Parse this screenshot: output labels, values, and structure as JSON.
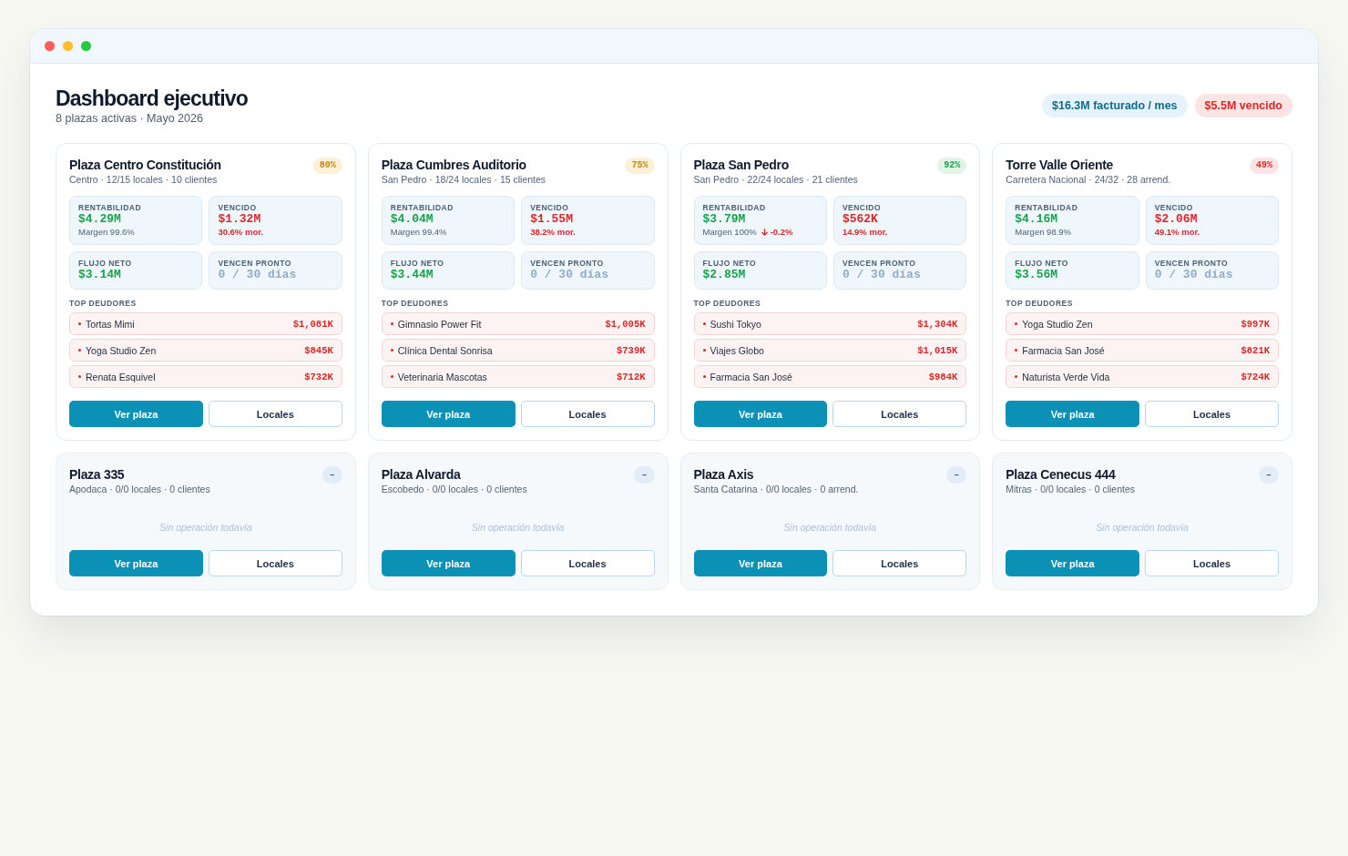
{
  "header": {
    "title": "Dashboard ejecutivo",
    "subtitle": "8 plazas activas · Mayo 2026",
    "pills": [
      {
        "text": "$16.3M facturado / mes",
        "kind": "info"
      },
      {
        "text": "$5.5M vencido",
        "kind": "danger"
      }
    ]
  },
  "plazas": [
    {
      "kind": "operating",
      "name": "Plaza Centro Constitución",
      "details": "Centro · 12/15 locales · 10 clientes",
      "badge": {
        "text": "80%",
        "kind": "warning"
      },
      "metrics": [
        {
          "label": "RENTABILIDAD",
          "value": "$4.29M",
          "kind": "positive",
          "note": {
            "text": "Margen 99.6%",
            "kind": "neutral"
          }
        },
        {
          "label": "VENCIDO",
          "value": "$1.32M",
          "kind": "negative",
          "note": {
            "text": "30.6% mor.",
            "kind": "negative"
          }
        },
        {
          "label": "FLUJO NETO",
          "value": "$3.14M",
          "kind": "positive"
        },
        {
          "label": "VENCEN PRONTO",
          "value": "0 / 30 días",
          "kind": "muted"
        }
      ],
      "debtors_title": "TOP DEUDORES",
      "debtors": [
        {
          "name": "Tortas Mimi",
          "amount": "$1,081K"
        },
        {
          "name": "Yoga Studio Zen",
          "amount": "$845K"
        },
        {
          "name": "Renata Esquivel",
          "amount": "$732K"
        }
      ],
      "actions": [
        {
          "label": "Ver plaza",
          "kind": "primary"
        },
        {
          "label": "Locales",
          "kind": "secondary"
        }
      ]
    },
    {
      "kind": "operating",
      "name": "Plaza Cumbres Auditorio",
      "details": "San Pedro · 18/24 locales · 15 clientes",
      "badge": {
        "text": "75%",
        "kind": "warning"
      },
      "metrics": [
        {
          "label": "RENTABILIDAD",
          "value": "$4.04M",
          "kind": "positive",
          "note": {
            "text": "Margen 99.4%",
            "kind": "neutral"
          }
        },
        {
          "label": "VENCIDO",
          "value": "$1.55M",
          "kind": "negative",
          "note": {
            "text": "38.2% mor.",
            "kind": "negative"
          }
        },
        {
          "label": "FLUJO NETO",
          "value": "$3.44M",
          "kind": "positive"
        },
        {
          "label": "VENCEN PRONTO",
          "value": "0 / 30 días",
          "kind": "muted"
        }
      ],
      "debtors_title": "TOP DEUDORES",
      "debtors": [
        {
          "name": "Gimnasio Power Fit",
          "amount": "$1,005K"
        },
        {
          "name": "Clínica Dental Sonrisa",
          "amount": "$739K"
        },
        {
          "name": "Veterinaria Mascotas",
          "amount": "$712K"
        }
      ],
      "actions": [
        {
          "label": "Ver plaza",
          "kind": "primary"
        },
        {
          "label": "Locales",
          "kind": "secondary"
        }
      ]
    },
    {
      "kind": "operating",
      "name": "Plaza San Pedro",
      "details": "San Pedro · 22/24 locales · 21 clientes",
      "badge": {
        "text": "92%",
        "kind": "success"
      },
      "metrics": [
        {
          "label": "RENTABILIDAD",
          "value": "$3.79M",
          "kind": "positive",
          "note": {
            "text": "Margen 100%",
            "kind": "neutral",
            "delta": {
              "text": "-0.2%",
              "kind": "down"
            }
          }
        },
        {
          "label": "VENCIDO",
          "value": "$562K",
          "kind": "negative",
          "note": {
            "text": "14.9% mor.",
            "kind": "negative"
          }
        },
        {
          "label": "FLUJO NETO",
          "value": "$2.85M",
          "kind": "positive"
        },
        {
          "label": "VENCEN PRONTO",
          "value": "0 / 30 días",
          "kind": "muted"
        }
      ],
      "debtors_title": "TOP DEUDORES",
      "debtors": [
        {
          "name": "Sushi Tokyo",
          "amount": "$1,304K"
        },
        {
          "name": "Viajes Globo",
          "amount": "$1,015K"
        },
        {
          "name": "Farmacia San José",
          "amount": "$984K"
        }
      ],
      "actions": [
        {
          "label": "Ver plaza",
          "kind": "primary"
        },
        {
          "label": "Locales",
          "kind": "secondary"
        }
      ]
    },
    {
      "kind": "operating",
      "name": "Torre Valle Oriente",
      "details": "Carretera Nacional · 24/32 · 28 arrend.",
      "badge": {
        "text": "49%",
        "kind": "danger"
      },
      "metrics": [
        {
          "label": "RENTABILIDAD",
          "value": "$4.16M",
          "kind": "positive",
          "note": {
            "text": "Margen 98.9%",
            "kind": "neutral"
          }
        },
        {
          "label": "VENCIDO",
          "value": "$2.06M",
          "kind": "negative",
          "note": {
            "text": "49.1% mor.",
            "kind": "negative"
          }
        },
        {
          "label": "FLUJO NETO",
          "value": "$3.56M",
          "kind": "positive"
        },
        {
          "label": "VENCEN PRONTO",
          "value": "0 / 30 días",
          "kind": "muted"
        }
      ],
      "debtors_title": "TOP DEUDORES",
      "debtors": [
        {
          "name": "Yoga Studio Zen",
          "amount": "$997K"
        },
        {
          "name": "Farmacia San José",
          "amount": "$821K"
        },
        {
          "name": "Naturista Verde Vida",
          "amount": "$724K"
        }
      ],
      "actions": [
        {
          "label": "Ver plaza",
          "kind": "primary"
        },
        {
          "label": "Locales",
          "kind": "secondary"
        }
      ]
    },
    {
      "kind": "empty",
      "name": "Plaza 335",
      "details": "Apodaca · 0/0 locales · 0 clientes",
      "badge": {
        "text": "–",
        "kind": "neutral"
      },
      "empty_message": "Sin operación todavía",
      "actions": [
        {
          "label": "Ver plaza",
          "kind": "primary"
        },
        {
          "label": "Locales",
          "kind": "secondary"
        }
      ]
    },
    {
      "kind": "empty",
      "name": "Plaza Alvarda",
      "details": "Escobedo · 0/0 locales · 0 clientes",
      "badge": {
        "text": "–",
        "kind": "neutral"
      },
      "empty_message": "Sin operación todavía",
      "actions": [
        {
          "label": "Ver plaza",
          "kind": "primary"
        },
        {
          "label": "Locales",
          "kind": "secondary"
        }
      ]
    },
    {
      "kind": "empty",
      "name": "Plaza Axis",
      "details": "Santa Catarina · 0/0 locales · 0 arrend.",
      "badge": {
        "text": "–",
        "kind": "neutral"
      },
      "empty_message": "Sin operación todavía",
      "actions": [
        {
          "label": "Ver plaza",
          "kind": "primary"
        },
        {
          "label": "Locales",
          "kind": "secondary"
        }
      ]
    },
    {
      "kind": "empty",
      "name": "Plaza Cenecus 444",
      "details": "Mitras · 0/0 locales · 0 clientes",
      "badge": {
        "text": "–",
        "kind": "neutral"
      },
      "empty_message": "Sin operación todavía",
      "actions": [
        {
          "label": "Ver plaza",
          "kind": "primary"
        },
        {
          "label": "Locales",
          "kind": "secondary"
        }
      ]
    }
  ]
}
